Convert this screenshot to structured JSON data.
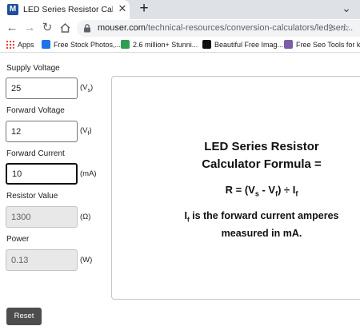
{
  "browser": {
    "tab_title": "LED Series Resistor Calculator | M",
    "tab_favicon_letter": "M",
    "url_host": "mouser.com",
    "url_path": "/technical-resources/conversion-calculators/led-seri...",
    "icons": {
      "back": "arrow-left-icon",
      "forward": "arrow-right-icon",
      "reload": "reload-icon",
      "home": "home-icon",
      "lock": "lock-icon",
      "share": "share-icon",
      "star": "star-icon",
      "new_tab": "plus-icon",
      "close": "close-icon"
    },
    "bookmarks": [
      {
        "label": "Apps",
        "color": "#5f6368"
      },
      {
        "label": "Free Stock Photos,...",
        "color": "#1a73e8"
      },
      {
        "label": "2.6 million+ Stunni...",
        "color": "#2e9e4f"
      },
      {
        "label": "Beautiful Free Imag...",
        "color": "#111111"
      },
      {
        "label": "Free Seo Tools for k...",
        "color": "#7b5ea7"
      }
    ]
  },
  "calculator": {
    "supply_voltage": {
      "label": "Supply Voltage",
      "value": "25",
      "unit_main": "V",
      "unit_sub": "s"
    },
    "forward_voltage": {
      "label": "Forward Voltage",
      "value": "12",
      "unit_main": "V",
      "unit_sub": "f"
    },
    "forward_current": {
      "label": "Forward Current",
      "value": "10",
      "unit": "(mA)"
    },
    "resistor_value": {
      "label": "Resistor Value",
      "value": "1300",
      "unit": "(Ω)"
    },
    "power": {
      "label": "Power",
      "value": "0.13",
      "unit": "(W)"
    },
    "reset_label": "Reset"
  },
  "formula": {
    "title_line1": "LED Series Resistor",
    "title_line2": "Calculator Formula =",
    "formula_lhs": "R = (V",
    "formula_vs_sub": "s",
    "formula_mid": " - V",
    "formula_vf_sub": "f",
    "formula_rhs": ") ÷ I",
    "formula_if_sub": "f",
    "note_main": "I",
    "note_sub": "f",
    "note_line1_rest": " is the forward current amperes",
    "note_line2": "measured in mA."
  }
}
